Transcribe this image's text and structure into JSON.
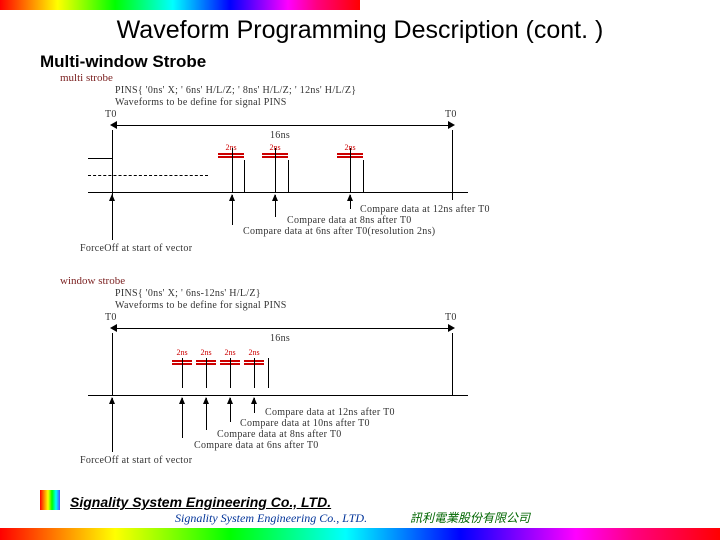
{
  "page": {
    "title": "Waveform Programming Description (cont. )",
    "subtitle": "Multi-window Strobe"
  },
  "section1": {
    "heading": "multi strobe",
    "code": "PINS{   '0ns'   X; '   6ns'   H/L/Z; '   8ns'   H/L/Z; '  12ns'   H/L/Z}",
    "desc": "Waveforms to be define for signal PINS",
    "t0_a": "T0",
    "t0_b": "T0",
    "period": "16ns",
    "seg1": "2ns",
    "seg2": "2ns",
    "seg3": "2ns",
    "cmp12": "Compare data at 12ns after T0",
    "cmp8": "Compare data at 8ns after T0",
    "cmp6": "Compare data at 6ns after T0(resolution 2ns)",
    "force": "ForceOff at start of vector"
  },
  "section2": {
    "heading": "window strobe",
    "code": "PINS{   '0ns'   X; '   6ns-12ns'   H/L/Z}",
    "desc": "Waveforms to be define for signal PINS",
    "t0_a": "T0",
    "t0_b": "T0",
    "period": "16ns",
    "seg": "2ns",
    "cmp12": "Compare data at 12ns after T0",
    "cmp10": "Compare data at 10ns after T0",
    "cmp8": "Compare data at 8ns after T0",
    "cmp6": "Compare data at 6ns after T0",
    "force": "ForceOff at start of vector"
  },
  "company": "Signality System Engineering Co., LTD.",
  "footer": {
    "en": "Signality System Engineering Co., LTD.",
    "zh": "訊利電業股份有限公司"
  }
}
